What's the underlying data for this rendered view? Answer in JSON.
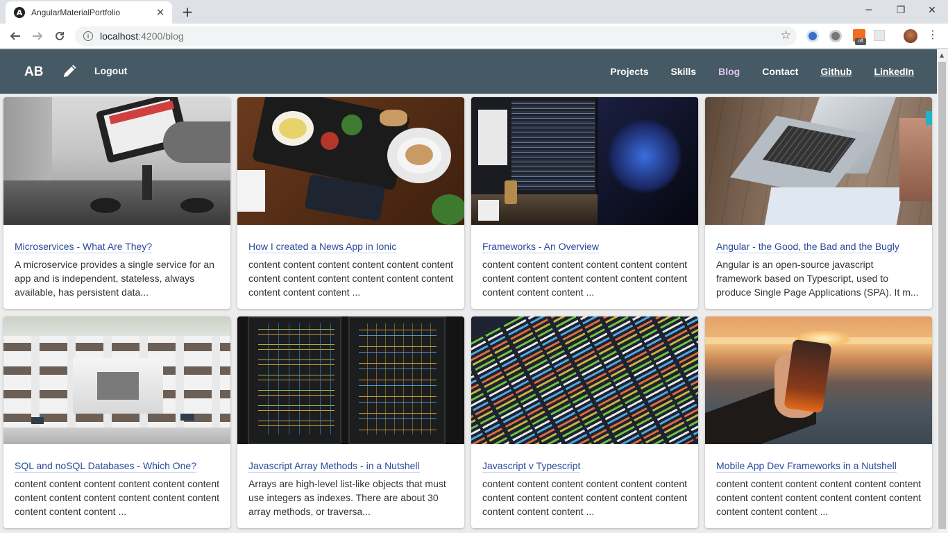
{
  "browser": {
    "tab_title": "AngularMaterialPortfolio",
    "tab_favicon": "A",
    "url_host": "localhost",
    "url_path": ":4200/blog",
    "new_tab_label": "+",
    "ext_off_badge": "off"
  },
  "app": {
    "brand": "AB",
    "logout_label": "Logout",
    "nav": [
      {
        "label": "Projects"
      },
      {
        "label": "Skills"
      },
      {
        "label": "Blog",
        "active": true
      },
      {
        "label": "Contact"
      },
      {
        "label": "Github"
      },
      {
        "label": "LinkedIn"
      }
    ],
    "colors": {
      "appbar": "#455a64",
      "active_nav": "#e2c2f0",
      "link": "#2a4b9b"
    }
  },
  "posts": [
    {
      "title": "Microservices - What Are They?",
      "excerpt": "A microservice provides a single service for an app and is independent, stateless, always available, has persistent data...",
      "image": "tablet-office-photo"
    },
    {
      "title": "How I created a News App in Ionic",
      "excerpt": "content content content content content content content content content content content content content content content ...",
      "image": "breakfast-phone-photo"
    },
    {
      "title": "Frameworks - An Overview",
      "excerpt": "content content content content content content content content content content content content content content content ...",
      "image": "monitors-pc-photo"
    },
    {
      "title": "Angular - the Good, the Bad and the Bugly",
      "excerpt": "Angular is an open-source javascript framework based on Typescript, used to produce Single Page Applications (SPA). It m...",
      "image": "laptop-desk-photo"
    },
    {
      "title": "SQL and noSQL Databases - Which One?",
      "excerpt": "content content content content content content content content content content content content content content content ...",
      "image": "library-photo"
    },
    {
      "title": "Javascript Array Methods - in a Nutshell",
      "excerpt": "Arrays are high-level list-like objects that must use integers as indexes. There are about 30 array methods, or traversa...",
      "image": "server-cables-photo"
    },
    {
      "title": "Javascript v Typescript",
      "excerpt": "content content content content content content content content content content content content content content content ...",
      "image": "code-screen-photo"
    },
    {
      "title": "Mobile App Dev Frameworks in a Nutshell",
      "excerpt": "content content content content content content content content content content content content content content content ...",
      "image": "phone-sunset-photo"
    }
  ]
}
